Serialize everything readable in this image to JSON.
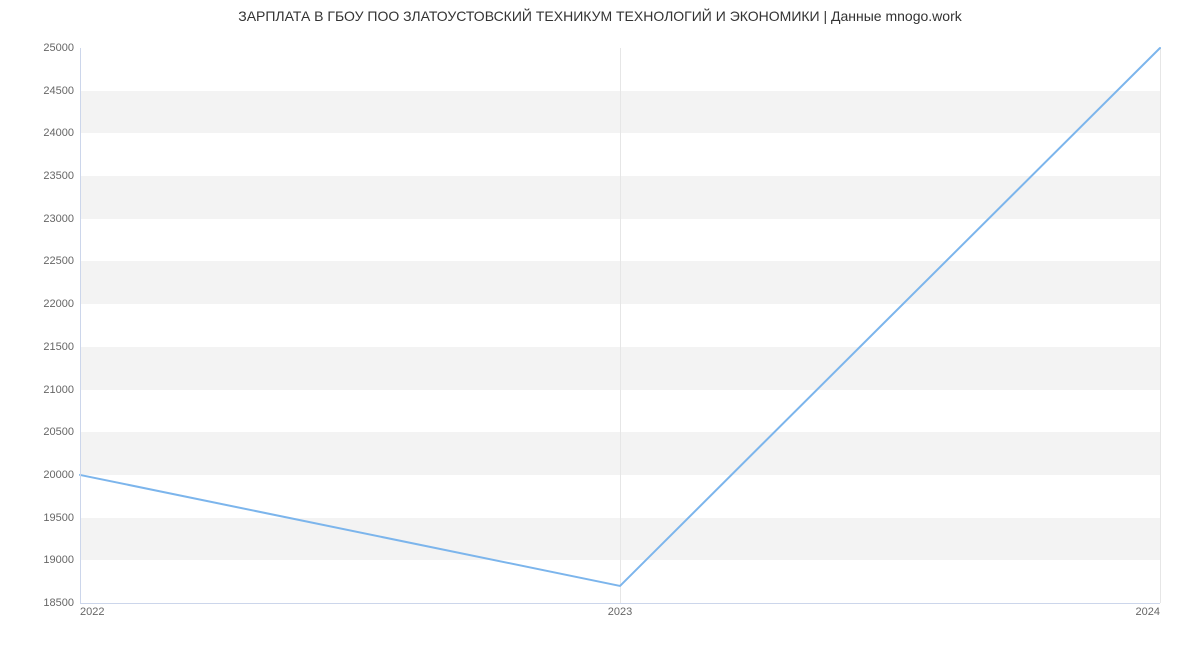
{
  "chart_data": {
    "type": "line",
    "title": "ЗАРПЛАТА В ГБОУ ПОО ЗЛАТОУСТОВСКИЙ ТЕХНИКУМ ТЕХНОЛОГИЙ И ЭКОНОМИКИ | Данные mnogo.work",
    "x": [
      "2022",
      "2023",
      "2024"
    ],
    "values": [
      20000,
      18700,
      25000
    ],
    "xlabel": "",
    "ylabel": "",
    "ylim": [
      18500,
      25000
    ],
    "y_ticks": [
      18500,
      19000,
      19500,
      20000,
      20500,
      21000,
      21500,
      22000,
      22500,
      23000,
      23500,
      24000,
      24500,
      25000
    ],
    "x_ticks": [
      "2022",
      "2023",
      "2024"
    ],
    "line_color": "#7cb5ec"
  }
}
